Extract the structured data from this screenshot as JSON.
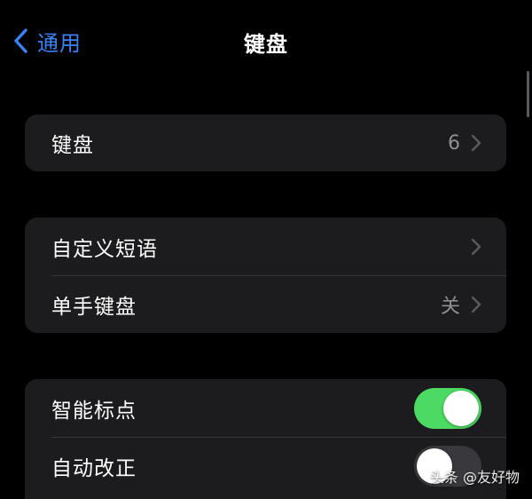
{
  "nav": {
    "back_label": "通用",
    "title": "键盘"
  },
  "groups": {
    "keyboards": {
      "label": "键盘",
      "value": "6"
    },
    "text": {
      "items": [
        {
          "label": "自定义短语",
          "value": ""
        },
        {
          "label": "单手键盘",
          "value": "关"
        }
      ]
    },
    "toggles": {
      "items": [
        {
          "label": "智能标点",
          "state": "on"
        },
        {
          "label": "自动改正",
          "state": "off"
        }
      ]
    }
  },
  "watermark": "头条 @友好物",
  "colors": {
    "accent": "#3b82f6",
    "toggle_on": "#4cd964",
    "toggle_off": "#39393d",
    "group_bg": "#1c1c1e",
    "secondary_text": "#8e8e93"
  },
  "icons": {
    "back": "chevron-left-icon",
    "disclosure": "chevron-right-icon"
  }
}
